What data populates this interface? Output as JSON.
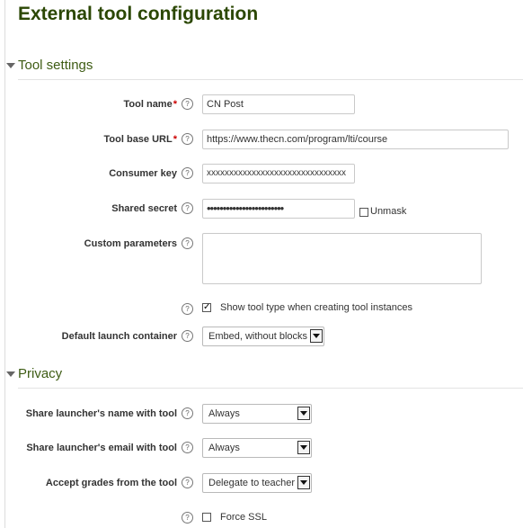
{
  "page": {
    "title": "External tool configuration"
  },
  "tool_settings": {
    "header": "Tool settings",
    "tool_name": {
      "label": "Tool name",
      "value": "CN Post"
    },
    "tool_base_url": {
      "label": "Tool base URL",
      "value": "https://www.thecn.com/program/lti/course"
    },
    "consumer_key": {
      "label": "Consumer key",
      "value": "xxxxxxxxxxxxxxxxxxxxxxxxxxxxxxx"
    },
    "shared_secret": {
      "label": "Shared secret",
      "value": "••••••••••••••••••••••••",
      "unmask_label": "Unmask"
    },
    "custom_parameters": {
      "label": "Custom parameters",
      "value": ""
    },
    "show_tool_type": {
      "label": "Show tool type when creating tool instances",
      "checked": true
    },
    "default_launch_container": {
      "label": "Default launch container",
      "value": "Embed, without blocks"
    }
  },
  "privacy": {
    "header": "Privacy",
    "share_name": {
      "label": "Share launcher's name with tool",
      "value": "Always"
    },
    "share_email": {
      "label": "Share launcher's email with tool",
      "value": "Always"
    },
    "accept_grades": {
      "label": "Accept grades from the tool",
      "value": "Delegate to teacher"
    },
    "force_ssl": {
      "label": "Force SSL",
      "checked": false
    }
  },
  "icons": {
    "help": "help-icon",
    "required": "required-asterisk"
  },
  "colors": {
    "title": "#2b4703",
    "section": "#3e5c14",
    "required": "#cc0000"
  }
}
